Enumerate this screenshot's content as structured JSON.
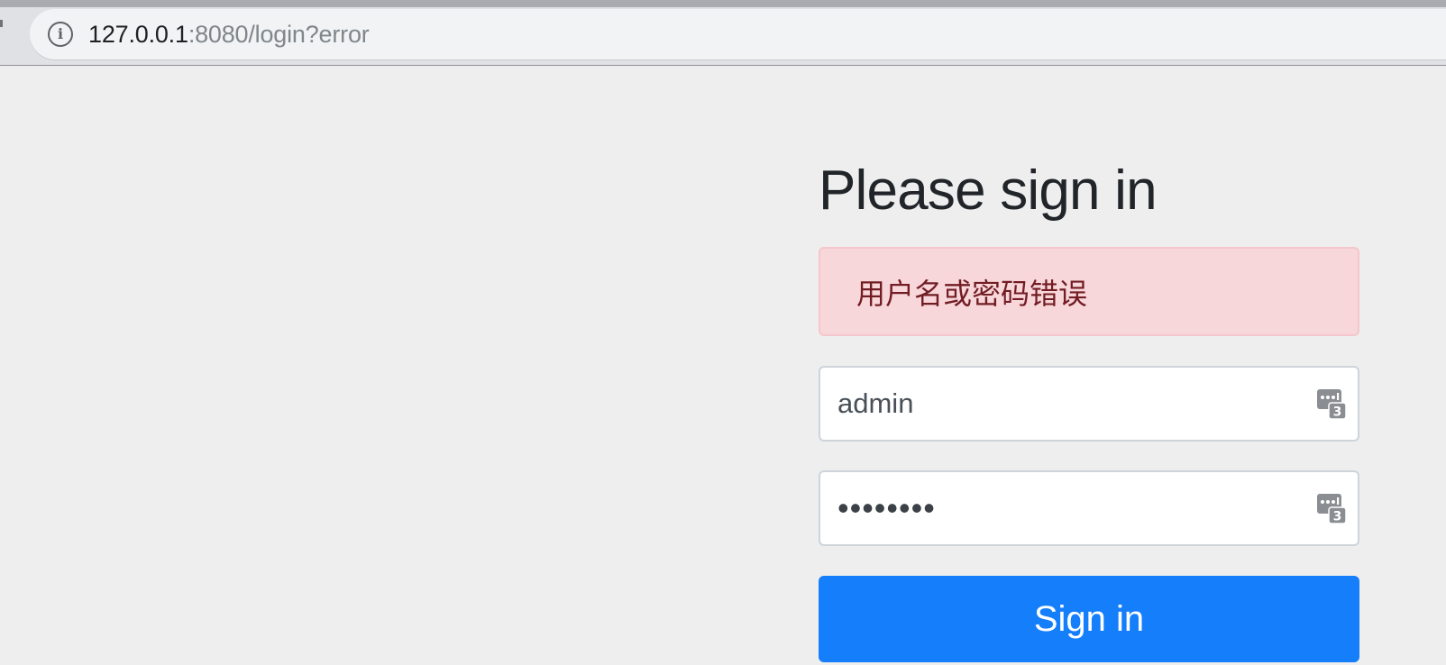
{
  "browser": {
    "url_host": "127.0.0.1",
    "url_rest": ":8080/login?error",
    "info_icon": "info-icon"
  },
  "form": {
    "heading": "Please sign in",
    "error_message": "用户名或密码错误",
    "username_value": "admin",
    "password_value": "••••••••",
    "password_manager_icon": "password-manager-icon",
    "submit_label": "Sign in"
  },
  "colors": {
    "page_background": "#eeeeee",
    "alert_background": "#f8d7da",
    "alert_text": "#721c24",
    "button_background": "#157efb",
    "button_text": "#ffffff",
    "heading_text": "#212529"
  }
}
